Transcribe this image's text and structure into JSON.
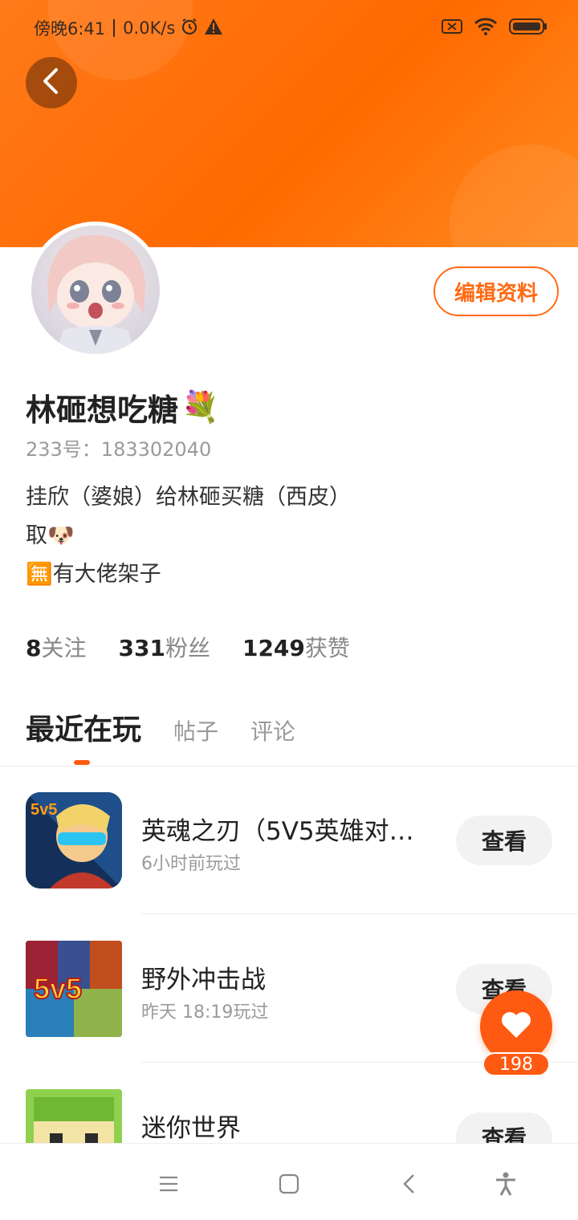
{
  "status_bar": {
    "time": "傍晚6:41",
    "network_speed": "0.0K/s",
    "icons": [
      "alarm-icon",
      "warning-icon",
      "sim-off-icon",
      "wifi-icon",
      "battery-icon"
    ]
  },
  "header": {
    "back_icon": "chevron-left-icon",
    "accent_color": "#ff6a13"
  },
  "profile": {
    "edit_label": "编辑资料",
    "username": "林砸想吃糖",
    "username_emoji": "💐",
    "id_label": "233号：183302040",
    "bio_lines": [
      {
        "text": "挂欣（婆娘）给林砸买糖（西皮）"
      },
      {
        "text": "取",
        "emoji": "🐶"
      },
      {
        "emoji": "🈚",
        "text": "有大佬架子"
      }
    ]
  },
  "stats": [
    {
      "value": "8",
      "label": "关注"
    },
    {
      "value": "331",
      "label": "粉丝"
    },
    {
      "value": "1249",
      "label": "获赞"
    }
  ],
  "tabs": {
    "active": "最近在玩",
    "others": [
      "帖子",
      "评论"
    ]
  },
  "games": [
    {
      "title": "英魂之刃（5V5英雄对战…",
      "time": "6小时前玩过",
      "button": "查看"
    },
    {
      "title": "野外冲击战",
      "time": "昨天 18:19玩过",
      "button": "查看"
    },
    {
      "title": "迷你世界",
      "time": "",
      "button": "查看"
    }
  ],
  "fab": {
    "icon": "heart-icon",
    "count": "198"
  },
  "nav_bar": {
    "icons": [
      "menu-icon",
      "home-icon",
      "back-icon",
      "accessibility-icon"
    ]
  }
}
